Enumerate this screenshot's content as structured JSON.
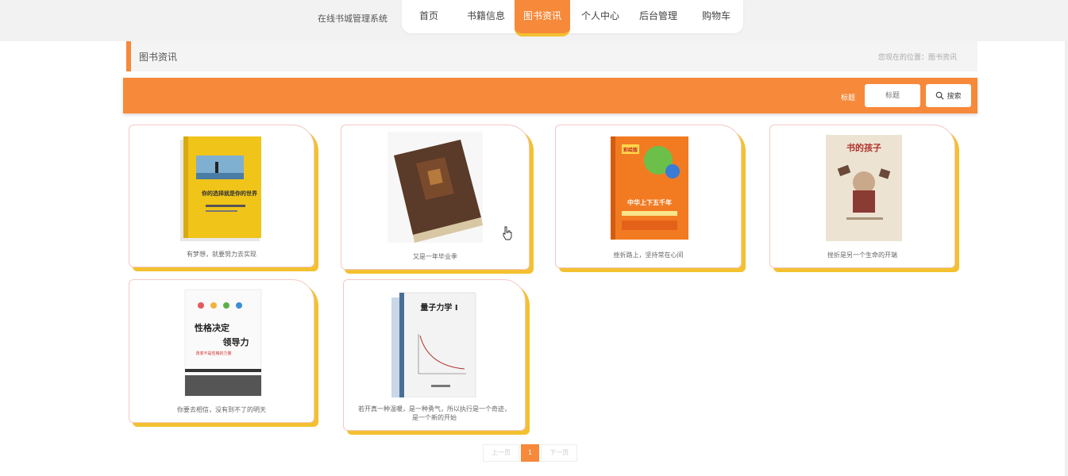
{
  "header": {
    "site_title": "在线书城管理系统",
    "nav": [
      {
        "label": "首页",
        "active": false
      },
      {
        "label": "书籍信息",
        "active": false
      },
      {
        "label": "图书资讯",
        "active": true
      },
      {
        "label": "个人中心",
        "active": false
      },
      {
        "label": "后台管理",
        "active": false
      },
      {
        "label": "购物车",
        "active": false
      }
    ]
  },
  "breadcrumb": {
    "title": "图书资讯",
    "location": "您现在的位置：图书资讯"
  },
  "search": {
    "label": "标题",
    "placeholder": "标题",
    "button_label": "搜索"
  },
  "news": [
    {
      "caption": "有梦想，就要努力去实现"
    },
    {
      "caption": "又是一年毕业季"
    },
    {
      "caption": "挫折路上，坚持常在心间"
    },
    {
      "caption": "挫折是另一个生命的开端"
    },
    {
      "caption": "你要去相信，没有到不了的明天"
    },
    {
      "caption": "若开真一种温暖，是一种勇气，所以执行是一个奇迹，是一个新的开始"
    }
  ],
  "covers": {
    "book1": {
      "title": "你的选择就是你的世界",
      "bg": "#f0c419"
    },
    "book3": {
      "title": "中华上下五千年",
      "badge": "彩绘版",
      "bg": "#f27b22"
    },
    "book4": {
      "title": "书的孩子"
    },
    "book5": {
      "title1": "性格决定",
      "title2": "领导力",
      "subtitle": "改变不是性格的力量"
    },
    "book6": {
      "title": "量子力学 I"
    }
  },
  "pagination": {
    "prev": "上一页",
    "current": "1",
    "next": "下一页"
  },
  "colors": {
    "accent": "#f6893a",
    "shadow": "#f3c130"
  }
}
